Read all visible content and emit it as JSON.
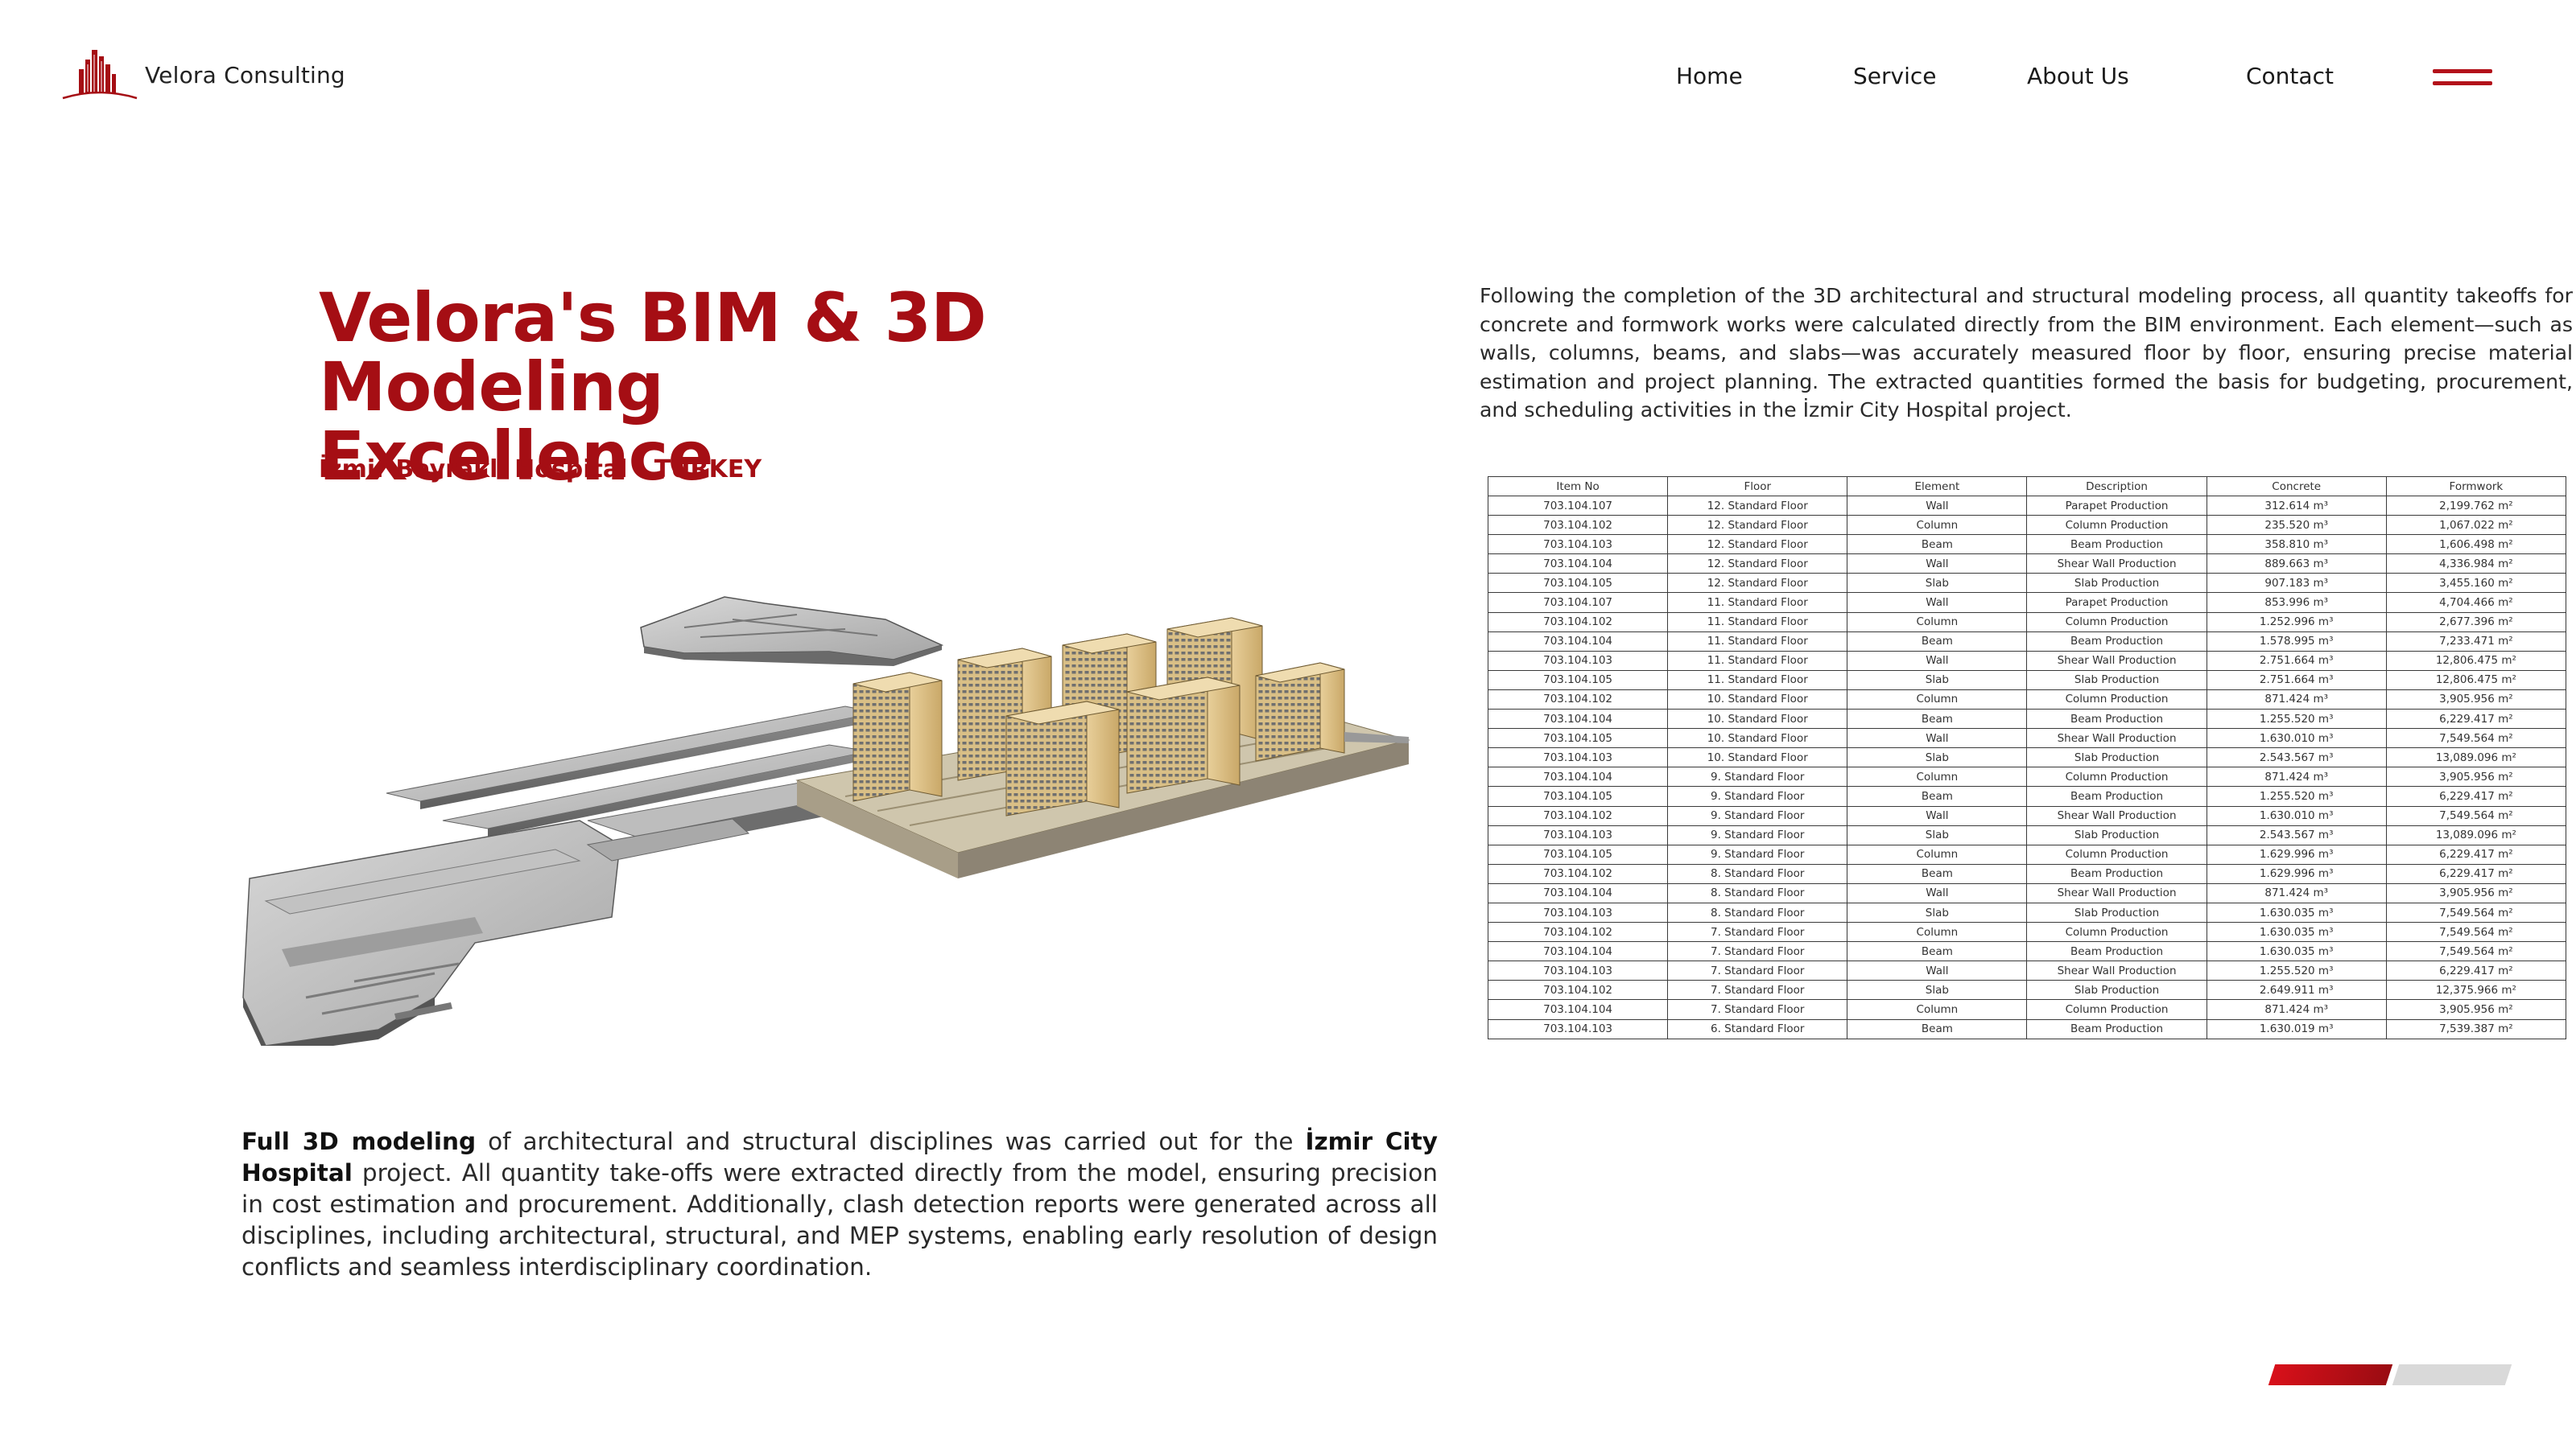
{
  "brand": {
    "name": "Velora Consulting",
    "logo_icon": "building-skyline-icon",
    "accent_color": "#a50e14"
  },
  "nav": {
    "items": [
      "Home",
      "Service",
      "About Us",
      "Contact"
    ],
    "menu_icon": "hamburger-menu-icon"
  },
  "hero": {
    "title_line1": "Velora's BIM & 3D",
    "title_line2": "Modeling Excellence",
    "subtitle": "İzmir Bayraklı Hospital - TURKEY"
  },
  "description": "Following the completion of the 3D architectural and structural modeling process, all quantity takeoffs for concrete and formwork works were calculated directly from the BIM environment. Each element—such as walls, columns, beams, and slabs—was accurately measured floor by floor, ensuring precise material estimation and project planning. The extracted quantities formed the basis for budgeting, procurement, and scheduling activities in the İzmir City Hospital project.",
  "table": {
    "headers": [
      "Item No",
      "Floor",
      "Element",
      "Description",
      "Concrete",
      "Formwork"
    ],
    "rows": [
      [
        "703.104.107",
        "12. Standard Floor",
        "Wall",
        "Parapet Production",
        "312.614 m³",
        "2,199.762 m²"
      ],
      [
        "703.104.102",
        "12. Standard Floor",
        "Column",
        "Column Production",
        "235.520 m³",
        "1,067.022 m²"
      ],
      [
        "703.104.103",
        "12. Standard Floor",
        "Beam",
        "Beam Production",
        "358.810 m³",
        "1,606.498 m²"
      ],
      [
        "703.104.104",
        "12. Standard Floor",
        "Wall",
        "Shear Wall Production",
        "889.663 m³",
        "4,336.984 m²"
      ],
      [
        "703.104.105",
        "12. Standard Floor",
        "Slab",
        "Slab Production",
        "907.183 m³",
        "3,455.160 m²"
      ],
      [
        "703.104.107",
        "11. Standard Floor",
        "Wall",
        "Parapet Production",
        "853.996 m³",
        "4,704.466 m²"
      ],
      [
        "703.104.102",
        "11. Standard Floor",
        "Column",
        "Column Production",
        "1.252.996 m³",
        "2,677.396 m²"
      ],
      [
        "703.104.104",
        "11. Standard Floor",
        "Beam",
        "Beam Production",
        "1.578.995 m³",
        "7,233.471 m²"
      ],
      [
        "703.104.103",
        "11. Standard Floor",
        "Wall",
        "Shear Wall Production",
        "2.751.664 m³",
        "12,806.475 m²"
      ],
      [
        "703.104.105",
        "11. Standard Floor",
        "Slab",
        "Slab Production",
        "2.751.664 m³",
        "12,806.475 m²"
      ],
      [
        "703.104.102",
        "10. Standard Floor",
        "Column",
        "Column Production",
        "871.424 m³",
        "3,905.956 m²"
      ],
      [
        "703.104.104",
        "10. Standard Floor",
        "Beam",
        "Beam Production",
        "1.255.520 m³",
        "6,229.417 m²"
      ],
      [
        "703.104.105",
        "10. Standard Floor",
        "Wall",
        "Shear Wall Production",
        "1.630.010 m³",
        "7,549.564 m²"
      ],
      [
        "703.104.103",
        "10. Standard Floor",
        "Slab",
        "Slab Production",
        "2.543.567 m³",
        "13,089.096 m²"
      ],
      [
        "703.104.104",
        "9. Standard Floor",
        "Column",
        "Column Production",
        "871.424 m³",
        "3,905.956 m²"
      ],
      [
        "703.104.105",
        "9. Standard Floor",
        "Beam",
        "Beam Production",
        "1.255.520 m³",
        "6,229.417 m²"
      ],
      [
        "703.104.102",
        "9. Standard Floor",
        "Wall",
        "Shear Wall Production",
        "1.630.010 m³",
        "7,549.564 m²"
      ],
      [
        "703.104.103",
        "9. Standard Floor",
        "Slab",
        "Slab Production",
        "2.543.567 m³",
        "13,089.096 m²"
      ],
      [
        "703.104.105",
        "9. Standard Floor",
        "Column",
        "Column Production",
        "1.629.996 m³",
        "6,229.417 m²"
      ],
      [
        "703.104.102",
        "8. Standard Floor",
        "Beam",
        "Beam Production",
        "1.629.996 m³",
        "6,229.417 m²"
      ],
      [
        "703.104.104",
        "8. Standard Floor",
        "Wall",
        "Shear Wall Production",
        "871.424 m³",
        "3,905.956 m²"
      ],
      [
        "703.104.103",
        "8. Standard Floor",
        "Slab",
        "Slab Production",
        "1.630.035 m³",
        "7,549.564 m²"
      ],
      [
        "703.104.102",
        "7. Standard Floor",
        "Column",
        "Column Production",
        "1.630.035 m³",
        "7,549.564 m²"
      ],
      [
        "703.104.104",
        "7. Standard Floor",
        "Beam",
        "Beam Production",
        "1.630.035 m³",
        "7,549.564 m²"
      ],
      [
        "703.104.103",
        "7. Standard Floor",
        "Wall",
        "Shear Wall Production",
        "1.255.520 m³",
        "6,229.417 m²"
      ],
      [
        "703.104.102",
        "7. Standard Floor",
        "Slab",
        "Slab Production",
        "2.649.911 m³",
        "12,375.966 m²"
      ],
      [
        "703.104.104",
        "7. Standard Floor",
        "Column",
        "Column Production",
        "871.424 m³",
        "3,905.956 m²"
      ],
      [
        "703.104.103",
        "6. Standard Floor",
        "Beam",
        "Beam Production",
        "1.630.019 m³",
        "7,539.387 m²"
      ]
    ]
  },
  "bottom": {
    "bold1": "Full 3D modeling",
    "text1": " of architectural and structural disciplines was carried out for the ",
    "bold2": "İzmir City Hospital",
    "text2": " project. All quantity take-offs were extracted directly from the model, ensuring precision in cost estimation and procurement. Additionally, clash detection reports were generated across all disciplines, including architectural, structural, and MEP systems, enabling early resolution of design conflicts and seamless interdisciplinary coordination."
  },
  "pager": {
    "slides": 2,
    "active": 1,
    "active_color": "#d8101a",
    "inactive_color": "#d9d9d9"
  }
}
